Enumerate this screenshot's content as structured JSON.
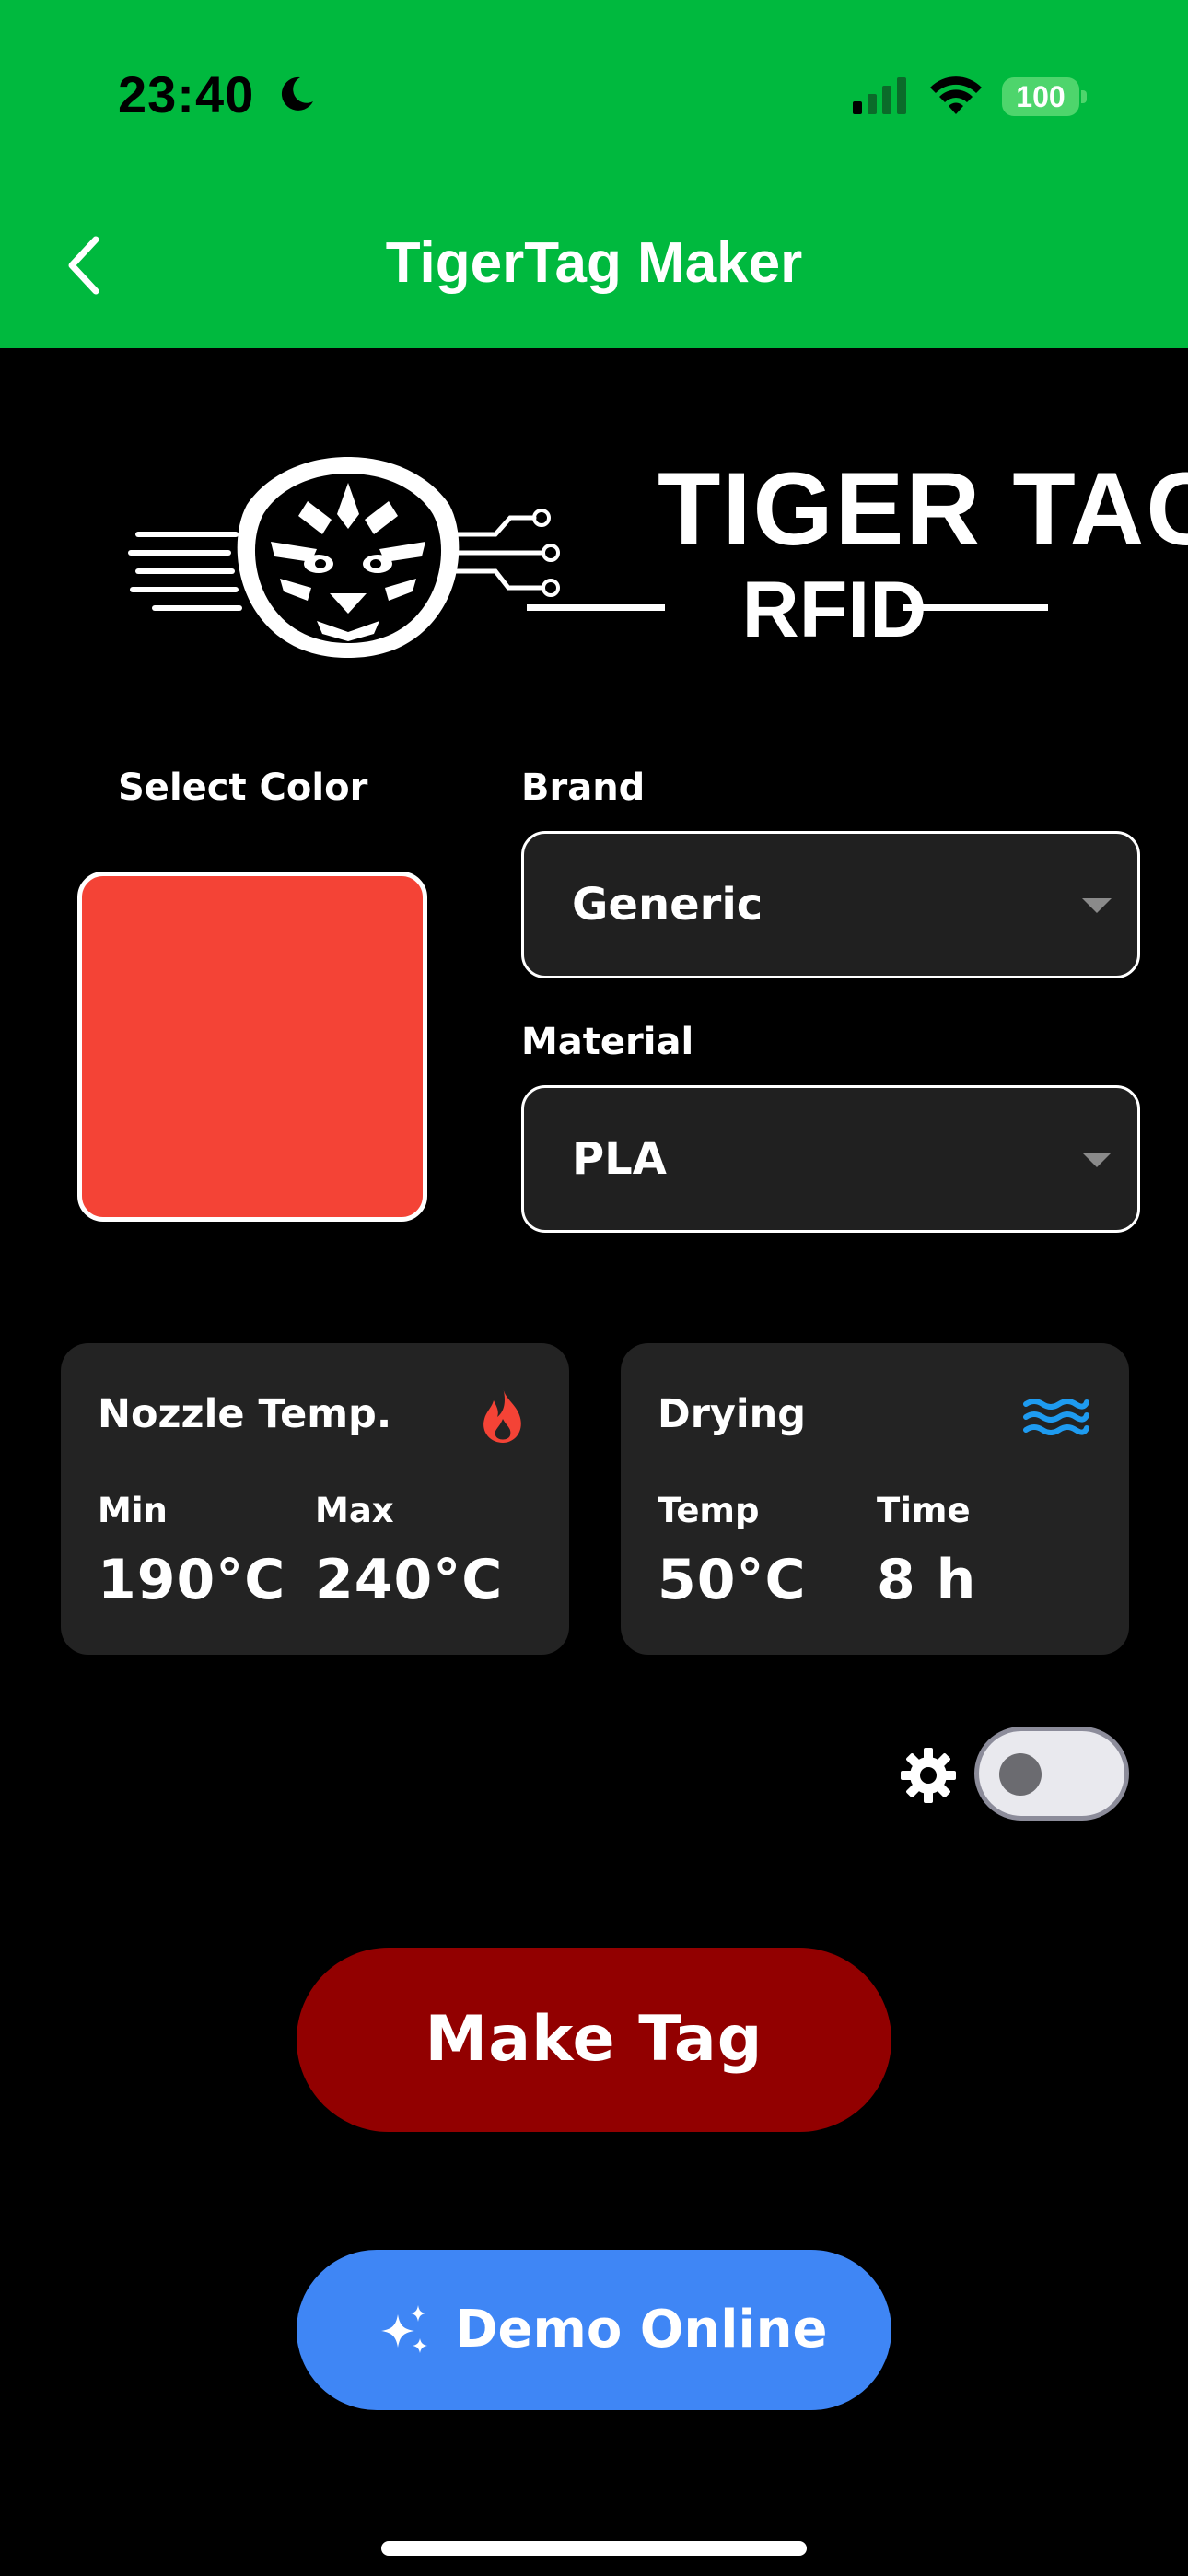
{
  "status_bar": {
    "time": "23:40",
    "battery": "100",
    "icons": [
      "moon-icon",
      "signal-icon",
      "wifi-icon",
      "battery-icon"
    ]
  },
  "nav": {
    "title": "TigerTag Maker",
    "back_icon": "chevron-left-icon"
  },
  "logo": {
    "line1": "TIGER TAG",
    "line2": "RFID"
  },
  "form": {
    "color_label": "Select Color",
    "selected_color": "#f44336",
    "brand_label": "Brand",
    "brand_value": "Generic",
    "material_label": "Material",
    "material_value": "PLA"
  },
  "nozzle_card": {
    "title": "Nozzle Temp.",
    "icon": "fire-icon",
    "min_label": "Min",
    "min_value": "190°C",
    "max_label": "Max",
    "max_value": "240°C"
  },
  "drying_card": {
    "title": "Drying",
    "icon": "waves-icon",
    "temp_label": "Temp",
    "temp_value": "50°C",
    "time_label": "Time",
    "time_value": "8 h"
  },
  "settings": {
    "icon": "gear-icon",
    "toggle_on": false
  },
  "actions": {
    "make_tag": "Make Tag",
    "demo_online": "Demo Online",
    "demo_icon": "sparkles-icon"
  },
  "colors": {
    "header_green": "#00b93e",
    "make_tag_red": "#920000",
    "demo_blue": "#3f86f5",
    "fire_red": "#f44336",
    "water_blue": "#1e9bf0"
  }
}
